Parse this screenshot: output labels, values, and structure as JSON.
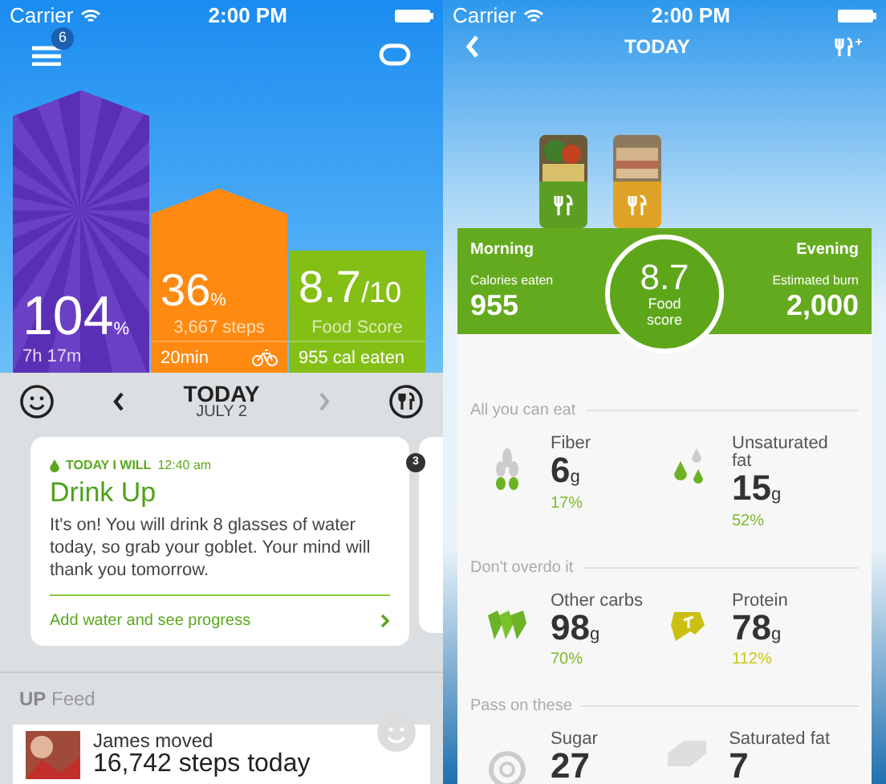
{
  "left_screen": {
    "status_bar": {
      "carrier": "Carrier",
      "time": "2:00 PM"
    },
    "header": {
      "menu_badge": "6"
    },
    "bars": [
      {
        "kind": "sleep",
        "value": "104",
        "unit": "%",
        "detail": "7h 17m"
      },
      {
        "kind": "move",
        "value": "36",
        "unit": "%",
        "detail": "3,667 steps",
        "footer": "20min"
      },
      {
        "kind": "food",
        "value": "8.7",
        "unit": "/10",
        "detail": "Food Score",
        "footer": "955 cal eaten"
      }
    ],
    "date_nav": {
      "title": "TODAY",
      "date": "JULY 2"
    },
    "card": {
      "tag": "TODAY I WILL",
      "time": "12:40 am",
      "title": "Drink Up",
      "body": "It's on! You will drink 8 glasses of water today, so grab your goblet. Your mind will thank you tomorrow.",
      "link": "Add water and see progress",
      "next_badge": "3"
    },
    "feed": {
      "heading": "**UP** Feed",
      "items": [
        {
          "title": "James moved",
          "text": "16,742 steps today"
        }
      ]
    }
  },
  "right_screen": {
    "status_bar": {
      "carrier": "Carrier",
      "time": "2:00 PM"
    },
    "nav": {
      "title": "TODAY"
    },
    "summary": {
      "left_label": "Morning",
      "right_label": "Evening",
      "eaten_label": "Calories eaten",
      "eaten": "955",
      "burn_label": "Estimated burn",
      "burn": "2,000",
      "score": "8.7",
      "score_label": "Food score"
    },
    "sections": [
      {
        "title": "All you can eat",
        "items": [
          {
            "kind": "wheat",
            "name": "Fiber",
            "value": "6",
            "unit": "g",
            "percent": "17%",
            "color": "#7dbb2a"
          },
          {
            "kind": "drops",
            "name": "Unsaturated fat",
            "value": "15",
            "unit": "g",
            "percent": "52%",
            "color": "#7dbb2a"
          }
        ]
      },
      {
        "title": "Don't overdo it",
        "items": [
          {
            "kind": "bread",
            "name": "Other carbs",
            "value": "98",
            "unit": "g",
            "percent": "70%",
            "color": "#7dbb2a"
          },
          {
            "kind": "steak",
            "name": "Protein",
            "value": "78",
            "unit": "g",
            "percent": "112%",
            "color": "#c9c81a"
          }
        ]
      },
      {
        "title": "Pass on these",
        "items": [
          {
            "kind": "swirl",
            "name": "Sugar",
            "value": "27"
          },
          {
            "kind": "butter",
            "name": "Saturated fat",
            "value": "7"
          }
        ]
      }
    ]
  }
}
